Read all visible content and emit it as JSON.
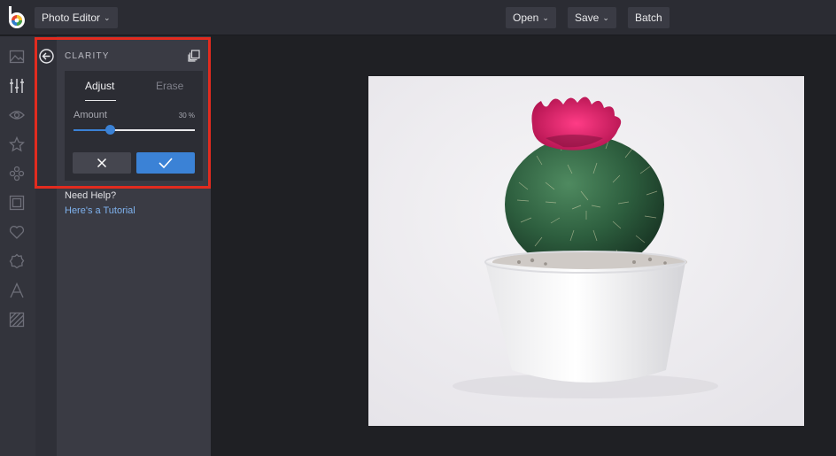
{
  "topbar": {
    "app_menu_label": "Photo Editor",
    "open_label": "Open",
    "save_label": "Save",
    "batch_label": "Batch"
  },
  "rail": {
    "tools": [
      "image-icon",
      "sliders-icon",
      "eye-icon",
      "star-icon",
      "effects-icon",
      "frame-icon",
      "heart-icon",
      "badge-icon",
      "text-icon",
      "texture-icon"
    ]
  },
  "panel": {
    "title": "CLARITY",
    "tabs": {
      "adjust": "Adjust",
      "erase": "Erase"
    },
    "amount_label": "Amount",
    "amount_value_text": "30 %",
    "amount_value": 30,
    "help_title": "Need Help?",
    "help_link": "Here's a Tutorial"
  },
  "colors": {
    "accent": "#3b82d6",
    "highlight": "#e22b1f",
    "topbar": "#2b2c33",
    "panel": "#3a3b44"
  }
}
